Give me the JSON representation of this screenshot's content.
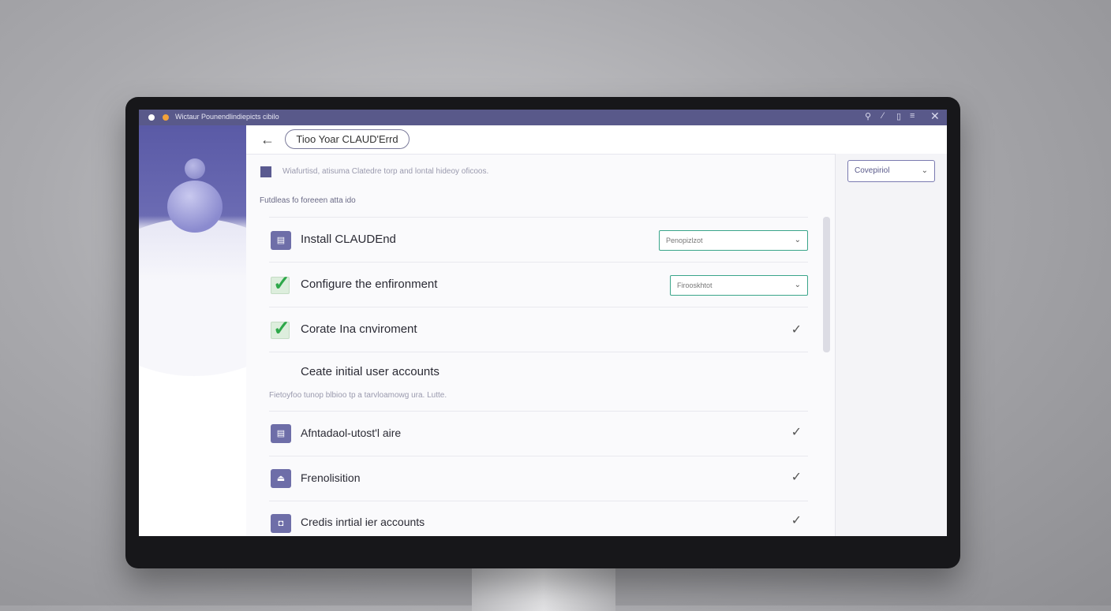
{
  "window": {
    "title": "Wictaur Pounendlindiepicts cibilo",
    "controls": [
      "⚲",
      "⁄",
      "▯",
      "≡",
      "✕"
    ]
  },
  "header": {
    "back_icon": "←",
    "title": "Tioo Yoar CLAUD'Errd",
    "icons": [
      "⏻",
      "▭",
      "⚙"
    ]
  },
  "notice": {
    "text": "Wiafurtisd, atisuma Clatedre torp and lontal hideoy oficoos."
  },
  "section_label": "Futdleas fo foreeen atta ido",
  "steps": [
    {
      "label": "Install CLAUDEnd",
      "icon": "▤",
      "status": "dropdown",
      "select_value": "Penopizlzot"
    },
    {
      "label": "Configure the enfironment",
      "icon": "check",
      "status": "dropdown",
      "select_value": "Firooskhtot"
    },
    {
      "label": "Corate Ina cnviroment",
      "icon": "check",
      "status": "done"
    },
    {
      "label": "Ceate initial user accounts",
      "icon": "none",
      "status": "none"
    }
  ],
  "hint": "Fietoyfoo tunop blbioo tp a tarvloamowg ura. Lutte.",
  "steps2": [
    {
      "label": "Afntadaol-utost'l aire",
      "icon": "▤",
      "status": "done"
    },
    {
      "label": "Frenolisition",
      "icon": "⏏",
      "status": "done"
    },
    {
      "label": "Credis inrtial ier accounts",
      "icon": "◘",
      "status": "done"
    }
  ],
  "right_panel": {
    "select_value": "Covepiriol"
  },
  "colors": {
    "accent": "#5a5aa6",
    "check_green": "#2ea84a",
    "select_border": "#3aa58a"
  }
}
